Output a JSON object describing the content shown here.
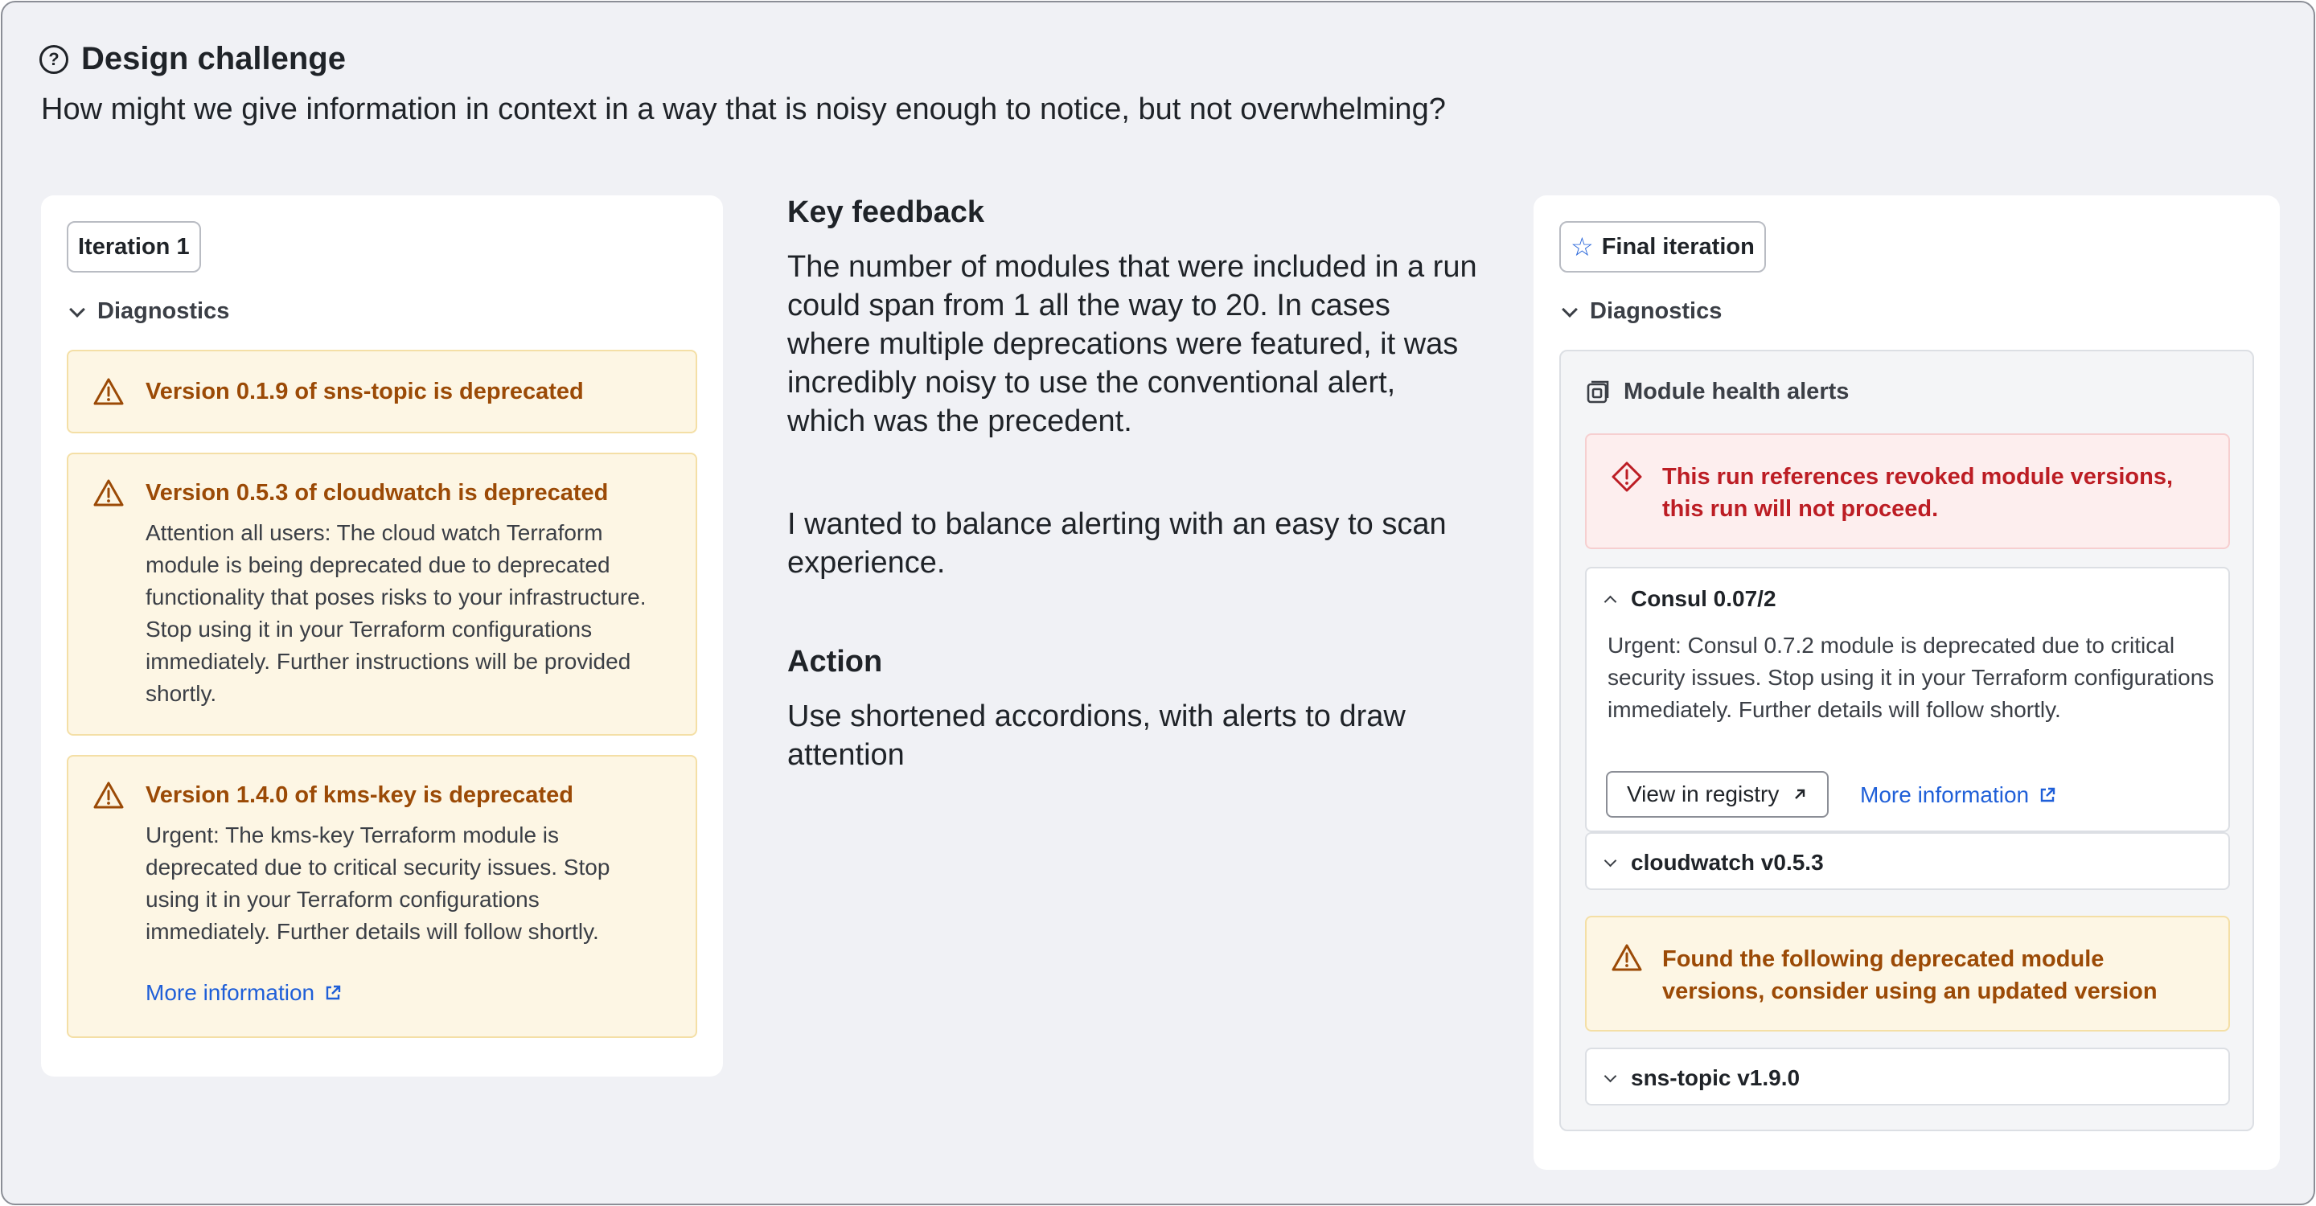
{
  "header": {
    "title": "Design challenge",
    "question": "How might we give information in context in a way that is noisy enough to notice, but not overwhelming?"
  },
  "iteration1": {
    "tag": "Iteration 1",
    "accordion_label": "Diagnostics",
    "alerts": [
      {
        "title": "Version 0.1.9 of sns-topic is deprecated"
      },
      {
        "title": "Version 0.5.3 of cloudwatch is deprecated",
        "body": "Attention all users: The cloud watch Terraform module is being deprecated due to deprecated functionality that poses risks to your infrastructure. Stop using it in your Terraform configurations immediately. Further instructions will be provided shortly."
      },
      {
        "title": "Version 1.4.0 of kms-key is deprecated",
        "body": "Urgent: The kms-key Terraform module is deprecated due to critical security issues. Stop using it in your Terraform configurations immediately. Further details will follow shortly.",
        "link": "More information"
      }
    ]
  },
  "middle": {
    "feedback_heading": "Key feedback",
    "feedback_p1": "The number of modules that were included in a run could span from 1 all the way to 20. In cases where multiple deprecations were featured, it was incredibly noisy to use the conventional alert, which was the precedent.",
    "feedback_p2": "I wanted to balance alerting with an easy to scan experience.",
    "action_heading": "Action",
    "action_p": "Use shortened accordions, with alerts to draw attention"
  },
  "final": {
    "tag": "Final iteration",
    "accordion_label": "Diagnostics",
    "panel_title": "Module health alerts",
    "error_alert": "This run references revoked module versions, this run will not proceed.",
    "consul": {
      "title": "Consul 0.07/2",
      "body": "Urgent: Consul 0.7.2 module is deprecated due to critical security issues. Stop using it in your Terraform configurations immediately. Further details will follow shortly.",
      "button": "View in registry",
      "link": "More information"
    },
    "cloudwatch_title": "cloudwatch v0.5.3",
    "warning_alert": "Found the following deprecated module versions, consider using an updated version",
    "sns_title": "sns-topic v1.9.0"
  },
  "colors": {
    "warning_text": "#9b4a06",
    "warning_bg": "#fdf6e4",
    "error_text": "#bc1d24",
    "error_bg": "#fdeeee",
    "link": "#1f5fd8"
  }
}
